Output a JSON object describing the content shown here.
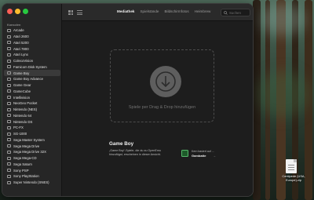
{
  "window": {
    "traffic_lights": {
      "close": "#ff5f57",
      "minimize": "#febc2e",
      "zoom": "#28c840"
    }
  },
  "sidebar": {
    "header": "Konsolen",
    "items": [
      {
        "label": "Arcade",
        "icon": "console-icon"
      },
      {
        "label": "Atari 2600",
        "icon": "console-icon"
      },
      {
        "label": "Atari 5200",
        "icon": "console-icon"
      },
      {
        "label": "Atari 7800",
        "icon": "console-icon"
      },
      {
        "label": "Atari Lynx",
        "icon": "handheld-icon"
      },
      {
        "label": "ColecoVision",
        "icon": "console-icon"
      },
      {
        "label": "Famicom Disk System",
        "icon": "console-icon"
      },
      {
        "label": "Game Boy",
        "icon": "handheld-icon",
        "selected": true
      },
      {
        "label": "Game Boy Advance",
        "icon": "handheld-icon"
      },
      {
        "label": "Game Gear",
        "icon": "handheld-icon"
      },
      {
        "label": "GameCube",
        "icon": "console-icon"
      },
      {
        "label": "Intellivision",
        "icon": "console-icon"
      },
      {
        "label": "NeoGeo Pocket",
        "icon": "handheld-icon"
      },
      {
        "label": "Nintendo (NES)",
        "icon": "console-icon"
      },
      {
        "label": "Nintendo 64",
        "icon": "console-icon"
      },
      {
        "label": "Nintendo DS",
        "icon": "handheld-icon"
      },
      {
        "label": "PC-FX",
        "icon": "console-icon"
      },
      {
        "label": "SG-1000",
        "icon": "console-icon"
      },
      {
        "label": "Sega Master System",
        "icon": "console-icon"
      },
      {
        "label": "Sega Mega Drive",
        "icon": "console-icon"
      },
      {
        "label": "Sega Mega Drive 32X",
        "icon": "console-icon"
      },
      {
        "label": "Sega Mega-CD",
        "icon": "console-icon"
      },
      {
        "label": "Sega Saturn",
        "icon": "console-icon"
      },
      {
        "label": "Sony PSP",
        "icon": "handheld-icon"
      },
      {
        "label": "Sony PlayStation",
        "icon": "console-icon"
      },
      {
        "label": "Super Nintendo (SNES)",
        "icon": "console-icon"
      }
    ]
  },
  "toolbar": {
    "tabs": [
      {
        "label": "Mediathek",
        "active": true
      },
      {
        "label": "Spielstände"
      },
      {
        "label": "Bildschirmfotos"
      },
      {
        "label": "Heimbrew"
      }
    ],
    "search_placeholder": "Suchen"
  },
  "drop_zone": {
    "text": "Spiele per Drag & Drop hinzufügen"
  },
  "info": {
    "title": "Game Boy",
    "description_line1": "„Game Boy“-Spiele, die du zu OpenEmu",
    "description_line2": "hinzufügst, erscheinen in dieser Ansicht.",
    "core_caption": "Kern basiert auf ...",
    "core_name": "Gambatte",
    "core_arrow": "→"
  },
  "desktop": {
    "file_label_line1": "Centipede (USA,",
    "file_label_line2": "Europe).zip"
  }
}
